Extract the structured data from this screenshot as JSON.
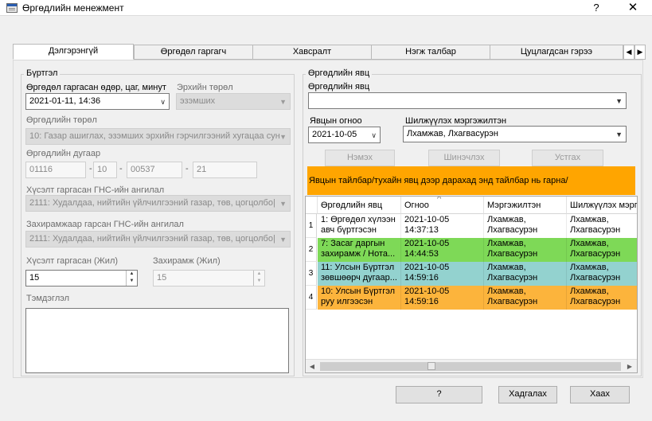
{
  "window": {
    "title": "Өргөдлийн менежмент",
    "help_glyph": "?",
    "close_glyph": "✕"
  },
  "tabs": [
    {
      "label": "Дэлгэрэнгүй",
      "active": true
    },
    {
      "label": "Өргөдөл гаргагч"
    },
    {
      "label": "Хавсралт"
    },
    {
      "label": "Нэгж талбар"
    },
    {
      "label": "Цуцлагдсан гэрээ"
    }
  ],
  "tab_scroll": {
    "left": "◀",
    "right": "▶"
  },
  "registration": {
    "group_title": "Бүртгэл",
    "submitted_label": "Өргөдөл гаргасан өдөр, цаг, минут",
    "submitted_value": "2021-01-11, 14:36",
    "right_type_label": "Эрхийн төрөл",
    "right_type_value": "эзэмших",
    "app_type_label": "Өргөдлийн төрөл",
    "app_type_value": "10: Газар ашиглах, эзэмших эрхийн гэрчилгээний хугацаа сун",
    "app_number_label": "Өргөдлийн дугаар",
    "app_number_parts": [
      "01116",
      "10",
      "00537",
      "21"
    ],
    "requested_lu_label": "Хүсэлт гаргасан ГНС-ийн ангилал",
    "requested_lu_value": "2111: Худалдаа, нийтийн үйлчилгээний газар, төв, цогцолбо|",
    "decided_lu_label": "Захирамжаар гарсан ГНС-ийн ангилал",
    "decided_lu_value": "2111: Худалдаа, нийтийн үйлчилгээний газар, төв, цогцолбо|",
    "requested_years_label": "Хүсэлт гаргасан (Жил)",
    "requested_years_value": "15",
    "decided_years_label": "Захирамж (Жил)",
    "decided_years_value": "15",
    "notes_label": "Тэмдэглэл",
    "notes_value": ""
  },
  "progress": {
    "group_title": "Өргөдлийн явц",
    "step_label": "Өргөдлийн явц",
    "step_value": "",
    "date_label": "Явцын огноо",
    "date_value": "2021-10-05",
    "officer_label": "Шилжүүлэх мэргэжилтэн",
    "officer_value": "Лхамжав, Лхагвасурэн",
    "add_label": "Нэмэх",
    "update_label": "Шинэчлэх",
    "delete_label": "Устгах",
    "banner_text": "Явцын тайлбар/тухайн явц дээр дарахад энд тайлбар нь гарна/",
    "banner_color": "#ffa500",
    "sort_glyph": "^"
  },
  "table": {
    "columns": [
      "Өргөдлийн явц",
      "Огноо",
      "Мэргэжилтэн",
      "Шилжүүлэх мэргэ"
    ],
    "rows": [
      {
        "num": "1",
        "color": "#ffffff",
        "step": [
          "1: Өргөдөл хүлээн",
          "авч бүртгэсэн"
        ],
        "date": [
          "2021-10-05",
          "14:37:13"
        ],
        "officer": [
          "Лхамжав,",
          "Лхагвасурэн"
        ],
        "to": [
          "Лхамжав,",
          "Лхагвасурэн"
        ]
      },
      {
        "num": "2",
        "color": "#7ed957",
        "step": [
          "7: Засаг даргын",
          "захирамж / Нота..."
        ],
        "date": [
          "2021-10-05",
          "14:44:53"
        ],
        "officer": [
          "Лхамжав,",
          "Лхагвасурэн"
        ],
        "to": [
          "Лхамжав,",
          "Лхагвасурэн"
        ]
      },
      {
        "num": "3",
        "color": "#93d2cf",
        "step": [
          "11: Улсын Бүртгэл",
          "зөвшөөрч дугаар..."
        ],
        "date": [
          "2021-10-05",
          "14:59:16"
        ],
        "officer": [
          "Лхамжав,",
          "Лхагвасурэн"
        ],
        "to": [
          "Лхамжав,",
          "Лхагвасурэн"
        ]
      },
      {
        "num": "4",
        "color": "#fcb43c",
        "step": [
          "10: Улсын Бүртгэл",
          "руу илгээсэн"
        ],
        "date": [
          "2021-10-05",
          "14:59:16"
        ],
        "officer": [
          "Лхамжав,",
          "Лхагвасурэн"
        ],
        "to": [
          "Лхамжав,",
          "Лхагвасурэн"
        ]
      }
    ]
  },
  "footer": {
    "help_label": "?",
    "save_label": "Хадгалах",
    "close_label": "Хаах"
  }
}
